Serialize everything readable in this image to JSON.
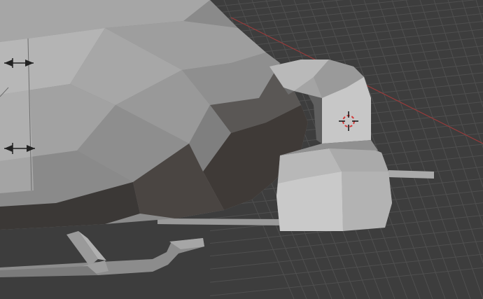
{
  "viewport": {
    "mode": "3D Viewport",
    "view": "solid-shading",
    "show_floor_grid": true,
    "x_axis_line_color": "#9a3a3a",
    "background_color": "#3d3d3d",
    "grid_color": "#4f4f4f"
  },
  "scene": {
    "object_type": "low-poly helicopter mesh",
    "visible_parts": [
      "fuselage-nose",
      "exhaust-duct",
      "engine-housing",
      "landing-skid",
      "side-shaft"
    ],
    "mesh_color": "#8f8f8f",
    "shadow_color": "#3a3633"
  },
  "overlays": {
    "cursor": "3d-cursor-icon",
    "empties": [
      "arrow-empty-icon",
      "arrow-empty-icon"
    ]
  }
}
